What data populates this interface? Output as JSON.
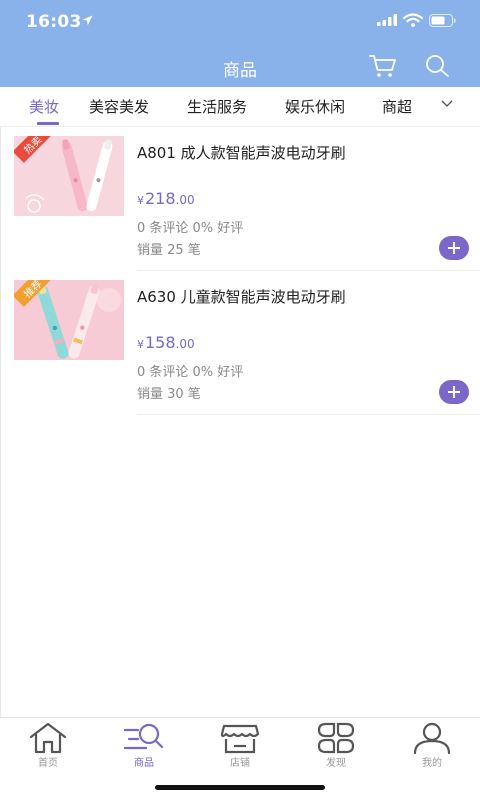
{
  "status_bar": {
    "time": "16:03"
  },
  "header": {
    "title": "商品"
  },
  "tabs": [
    {
      "label": "美妆"
    },
    {
      "label": "美容美发"
    },
    {
      "label": "生活服务"
    },
    {
      "label": "娱乐休闲"
    },
    {
      "label": "商超"
    }
  ],
  "products": [
    {
      "badge": "热卖",
      "name": "A801  成人款智能声波电动牙刷",
      "price_symbol": "¥",
      "price_int": "218",
      "price_dec": ".00",
      "reviews": "0 条评论 0% 好评",
      "sales": "销量 25 笔"
    },
    {
      "badge": "推荐",
      "name": "A630 儿童款智能声波电动牙刷",
      "price_symbol": "¥",
      "price_int": "158",
      "price_dec": ".00",
      "reviews": "0 条评论 0% 好评",
      "sales": "销量 30 笔"
    }
  ],
  "tabbar": [
    {
      "label": "首页",
      "icon": "home-icon"
    },
    {
      "label": "商品",
      "icon": "goods-list-icon"
    },
    {
      "label": "店铺",
      "icon": "store-icon"
    },
    {
      "label": "发现",
      "icon": "discover-icon"
    },
    {
      "label": "我的",
      "icon": "profile-icon"
    }
  ],
  "colors": {
    "header_bg": "#8ab2ea",
    "accent": "#7a67c9",
    "badge_red": "#e74c3c"
  }
}
